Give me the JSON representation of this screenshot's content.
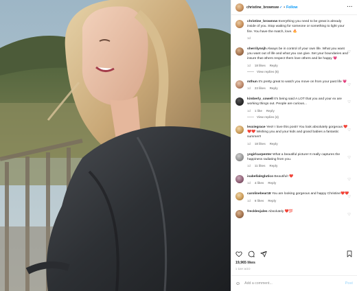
{
  "post": {
    "username": "christine_brownsw",
    "follow_label": "Follow",
    "caption": "Everything you need to be great is already inside of you. Stop waiting for someone or something to light your fire. You have the match, love. 🔥",
    "caption_time": "1d"
  },
  "comments": [
    {
      "user": "sherrilynnjh",
      "text": "Always be in control of your own life. What you want you want out of life and what you can give. Set your boundaries and insure that others respect them love others and be happy 💗",
      "time": "1d",
      "likes": "18 likes",
      "reply": "Reply",
      "replies": "View replies (5)"
    },
    {
      "user": "mthun",
      "text": "It's pretty great to watch you move on from your past life 💗",
      "time": "1d",
      "likes": "23 likes",
      "reply": "Reply"
    },
    {
      "user": "kimberly_cowell",
      "text": "It's being said A LOT that you and your ex are working things out. People are curious...",
      "time": "1d",
      "likes": "1 like",
      "reply": "Reply",
      "replies": "View replies (4)"
    },
    {
      "user": "lexxiegrace",
      "text": "Yes!! I love this post!! You look absolutely gorgeous ❤️❤️❤️ Wishing you and your kids and grand babies a fantastic summer!!",
      "time": "1d",
      "likes": "18 likes",
      "reply": "Reply"
    },
    {
      "user": "yogirlcarpenter",
      "text": "What a beautiful picture! It really captures the happiness radiating from you.",
      "time": "1d",
      "likes": "11 likes",
      "reply": "Reply"
    },
    {
      "user": "isabellaleglutico",
      "text": "Beautiful! ❤️",
      "time": "1d",
      "likes": "4 likes",
      "reply": "Reply"
    },
    {
      "user": "carolinebear18",
      "text": "You are looking gorgeous and happy Christine❤️❤️",
      "time": "1d",
      "likes": "6 likes",
      "reply": "Reply"
    },
    {
      "user": "frecklesjules",
      "text": "Absolutely ❤️💯",
      "time": "",
      "likes": "",
      "reply": ""
    }
  ],
  "footer": {
    "likes": "19,965 likes",
    "time": "1 DAY AGO",
    "comment_placeholder": "Add a comment...",
    "post_label": "Post"
  },
  "colors": {
    "accent": "#0095f6",
    "verified": "#3897f0",
    "heart": "#ed4956"
  },
  "icons": [
    "verified-icon",
    "more-icon",
    "heart-icon",
    "comment-icon",
    "share-icon",
    "save-icon",
    "emoji-icon"
  ]
}
